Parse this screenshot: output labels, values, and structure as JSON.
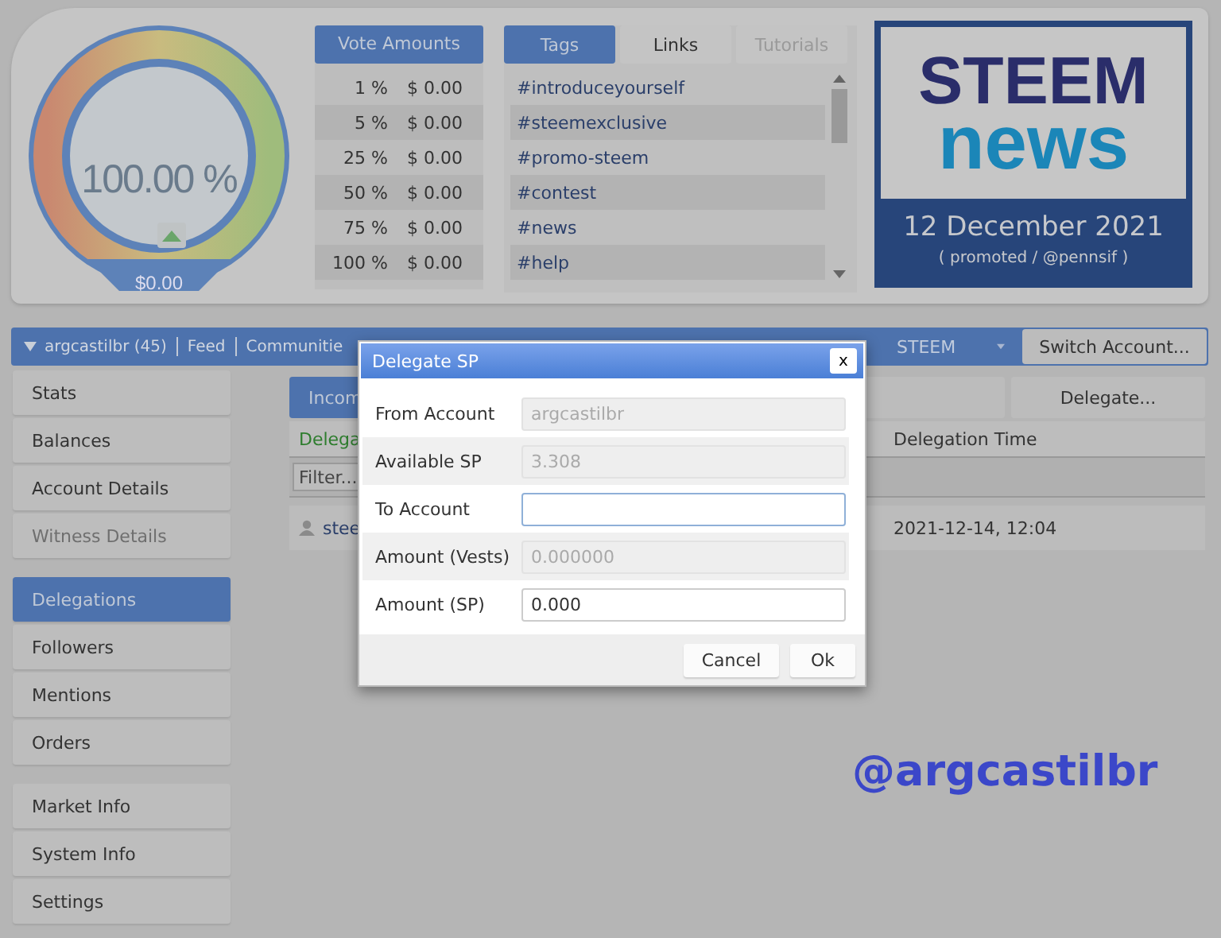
{
  "gauge": {
    "percent": "100.00 %",
    "value": "$0.00"
  },
  "vote_amounts": {
    "title": "Vote Amounts",
    "rows": [
      {
        "percent": "1 %",
        "amount": "$ 0.00"
      },
      {
        "percent": "5 %",
        "amount": "$ 0.00"
      },
      {
        "percent": "25 %",
        "amount": "$ 0.00"
      },
      {
        "percent": "50 %",
        "amount": "$ 0.00"
      },
      {
        "percent": "75 %",
        "amount": "$ 0.00"
      },
      {
        "percent": "100 %",
        "amount": "$ 0.00"
      }
    ]
  },
  "tag_tabs": [
    {
      "label": "Tags",
      "selected": true,
      "disabled": false
    },
    {
      "label": "Links",
      "selected": false,
      "disabled": false
    },
    {
      "label": "Tutorials",
      "selected": false,
      "disabled": true
    }
  ],
  "tags": [
    "#introduceyourself",
    "#steemexclusive",
    "#promo-steem",
    "#contest",
    "#news",
    "#help"
  ],
  "banner": {
    "line1": "STEEM",
    "line2": "news",
    "date": "12 December 2021",
    "credit": "( promoted / @pennsif )"
  },
  "nav": {
    "account": "argcastilbr (45)",
    "links": [
      "Feed",
      "Communitie"
    ],
    "currency": "STEEM",
    "switch_button": "Switch Account..."
  },
  "sidebar": [
    [
      {
        "label": "Stats",
        "selected": false,
        "disabled": false
      },
      {
        "label": "Balances",
        "selected": false,
        "disabled": false
      },
      {
        "label": "Account Details",
        "selected": false,
        "disabled": false
      },
      {
        "label": "Witness Details",
        "selected": false,
        "disabled": true
      }
    ],
    [
      {
        "label": "Delegations",
        "selected": true,
        "disabled": false
      },
      {
        "label": "Followers",
        "selected": false,
        "disabled": false
      },
      {
        "label": "Mentions",
        "selected": false,
        "disabled": false
      },
      {
        "label": "Orders",
        "selected": false,
        "disabled": false
      }
    ],
    [
      {
        "label": "Market Info",
        "selected": false,
        "disabled": false
      },
      {
        "label": "System Info",
        "selected": false,
        "disabled": false
      },
      {
        "label": "Settings",
        "selected": false,
        "disabled": false
      }
    ]
  ],
  "content": {
    "tab": "Incom",
    "delegate_button": "Delegate...",
    "columns": [
      "Delega",
      "Delegation Time"
    ],
    "filter_placeholder": "Filter...",
    "rows": [
      [
        "stee",
        "2021-12-14, 12:04"
      ]
    ]
  },
  "dialog": {
    "title": "Delegate SP",
    "close": "x",
    "fields": [
      {
        "label": "From Account",
        "value": "argcastilbr",
        "disabled": true,
        "focused": false
      },
      {
        "label": "Available SP",
        "value": "3.308",
        "disabled": true,
        "focused": false
      },
      {
        "label": "To Account",
        "disabled": false,
        "focused": true
      },
      {
        "label": "Amount (Vests)",
        "value": "0.000000",
        "disabled": true,
        "focused": false
      },
      {
        "label": "Amount (SP)",
        "value": "0.000",
        "disabled": false,
        "focused": false
      }
    ],
    "buttons": [
      "Cancel",
      "Ok"
    ]
  },
  "signature": "@argcastilbr"
}
